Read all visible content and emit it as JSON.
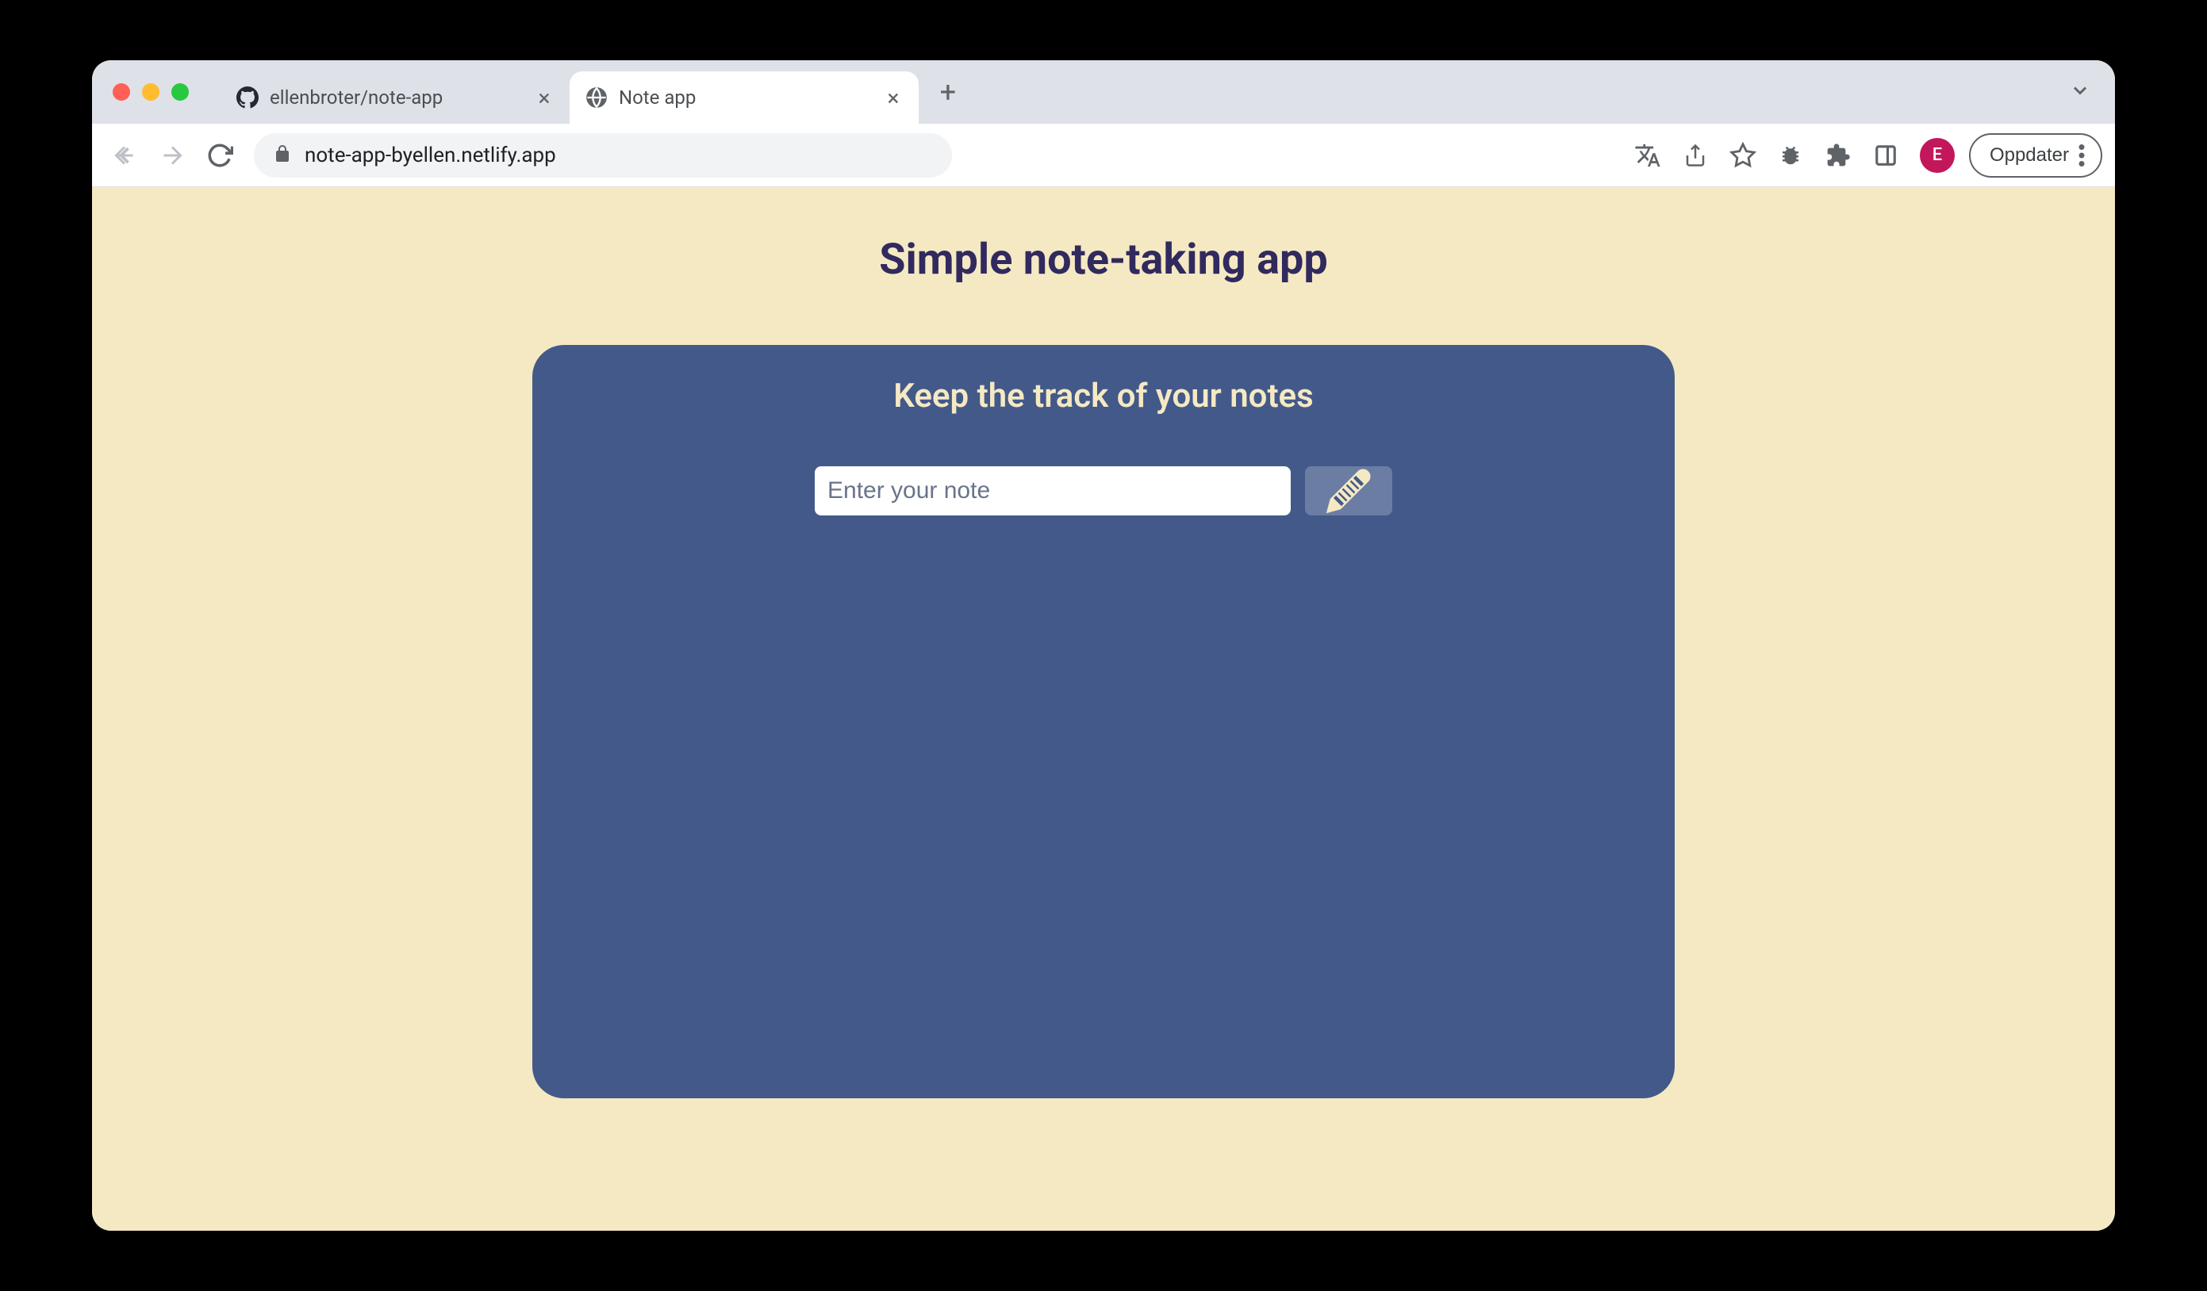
{
  "browser": {
    "tabs": [
      {
        "title": "ellenbroter/note-app",
        "favicon": "github"
      },
      {
        "title": "Note app",
        "favicon": "globe"
      }
    ],
    "url": "note-app-byellen.netlify.app",
    "update_button": "Oppdater",
    "avatar_letter": "E"
  },
  "page": {
    "title": "Simple note-taking app",
    "card": {
      "title": "Keep the track of your notes",
      "input_placeholder": "Enter your note"
    }
  }
}
